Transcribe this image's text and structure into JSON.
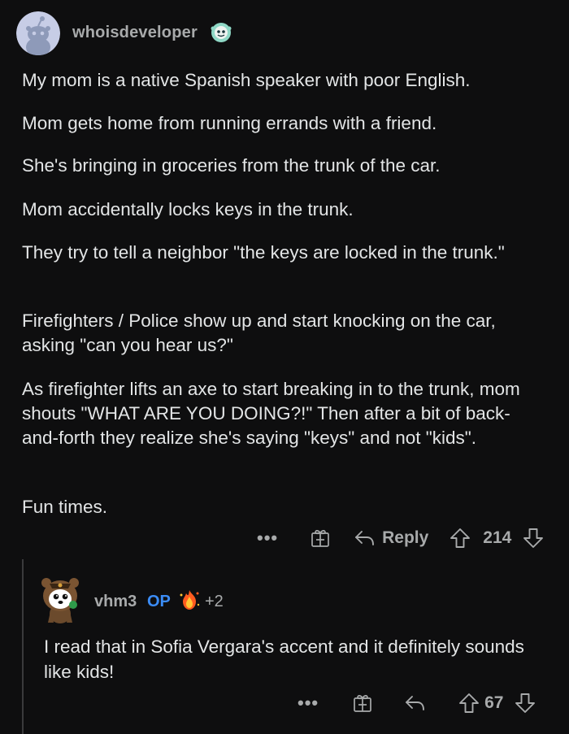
{
  "comment": {
    "username": "whoisdeveloper",
    "paragraphs": [
      "My mom is a native Spanish speaker with poor English.",
      "Mom gets home from running errands with a friend.",
      "She's bringing in groceries from the trunk of the car.",
      "Mom accidentally locks keys in the trunk.",
      "They try to tell a neighbor \"the keys are locked in the trunk.\"",
      "Firefighters / Police show up and start knocking on the car, asking \"can you hear us?\"",
      "As firefighter lifts an axe to start breaking in to the trunk, mom shouts \"WHAT ARE YOU DOING?!\" Then after a bit of back-and-forth they realize she's saying \"keys\" and not \"kids\".",
      "Fun times."
    ],
    "actions": {
      "more": "•••",
      "reply_label": "Reply",
      "votes": "214"
    }
  },
  "reply": {
    "username": "vhm3",
    "op_badge": "OP",
    "award_count": "+2",
    "text": "I read that in Sofia Vergara's accent and it definitely sounds like kids!",
    "actions": {
      "more": "•••",
      "votes": "67"
    }
  },
  "icons": {
    "award": "gift-award-icon",
    "reply": "reply-arrow-icon",
    "upvote": "upvote-arrow-icon",
    "downvote": "downvote-arrow-icon",
    "flair": "snoo-flair-icon",
    "reply_award": "fire-award-icon"
  },
  "colors": {
    "background": "#0e0e0f",
    "text": "#e3e5e6",
    "muted": "#a8aaab",
    "op": "#3b8cf5"
  }
}
